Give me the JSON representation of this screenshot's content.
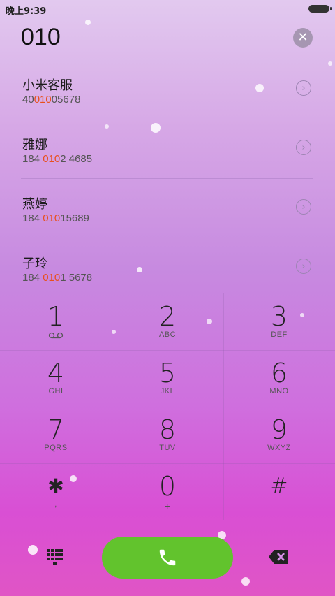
{
  "status_bar": {
    "time": "晚上9:39"
  },
  "dialer": {
    "input_value": "010"
  },
  "results": [
    {
      "name": "小米客服",
      "number_pre": "40",
      "number_match": "010",
      "number_post": "05678"
    },
    {
      "name": "雅娜",
      "number_pre": "184 ",
      "number_match": "010",
      "number_post": "2 4685"
    },
    {
      "name": "燕婷",
      "number_pre": "184 ",
      "number_match": "010",
      "number_post": "15689"
    },
    {
      "name": "子玲",
      "number_pre": "184 ",
      "number_match": "010",
      "number_post": "1 5678"
    }
  ],
  "keypad": {
    "k1": {
      "digit": "1",
      "letters": ""
    },
    "k2": {
      "digit": "2",
      "letters": "ABC"
    },
    "k3": {
      "digit": "3",
      "letters": "DEF"
    },
    "k4": {
      "digit": "4",
      "letters": "GHI"
    },
    "k5": {
      "digit": "5",
      "letters": "JKL"
    },
    "k6": {
      "digit": "6",
      "letters": "MNO"
    },
    "k7": {
      "digit": "7",
      "letters": "PQRS"
    },
    "k8": {
      "digit": "8",
      "letters": "TUV"
    },
    "k9": {
      "digit": "9",
      "letters": "WXYZ"
    },
    "kstar": {
      "digit": "✱",
      "letters": ","
    },
    "k0": {
      "digit": "0",
      "letters": "+"
    },
    "khash": {
      "digit": "#",
      "letters": ""
    }
  },
  "icons": {
    "clear": "close-icon",
    "chevron": "chevron-right-icon",
    "voicemail": "voicemail-icon",
    "keypad_toggle": "dialpad-icon",
    "call": "phone-icon",
    "backspace": "backspace-icon"
  },
  "colors": {
    "match_highlight": "#e8501d",
    "call_button": "#62c32d"
  }
}
